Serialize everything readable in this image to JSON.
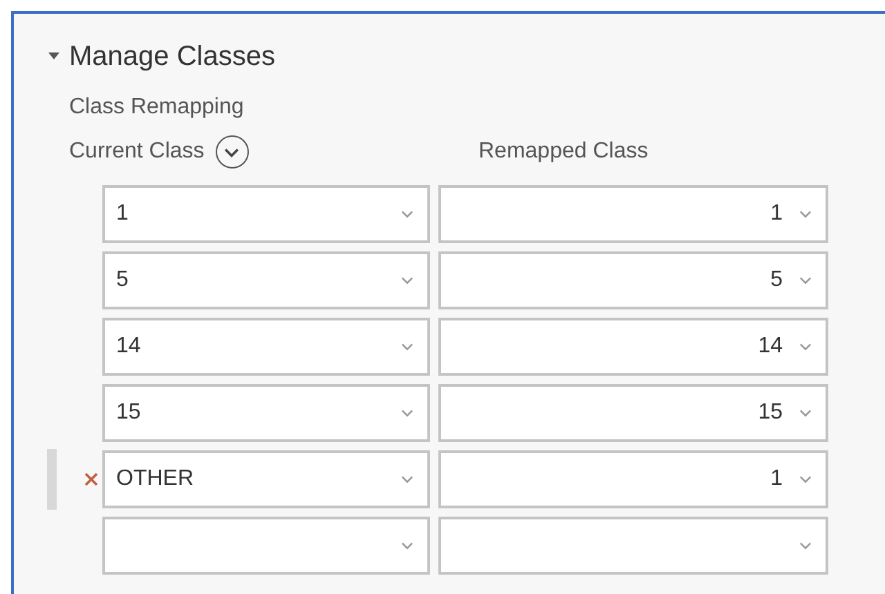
{
  "section": {
    "title": "Manage Classes",
    "expanded": true
  },
  "subtitle": "Class Remapping",
  "columns": [
    "Current Class",
    "Remapped Class"
  ],
  "rows": [
    {
      "current": "1",
      "remapped": "1",
      "selected": false
    },
    {
      "current": "5",
      "remapped": "5",
      "selected": false
    },
    {
      "current": "14",
      "remapped": "14",
      "selected": false
    },
    {
      "current": "15",
      "remapped": "15",
      "selected": false
    },
    {
      "current": "OTHER",
      "remapped": "1",
      "selected": true
    },
    {
      "selected": false
    }
  ]
}
